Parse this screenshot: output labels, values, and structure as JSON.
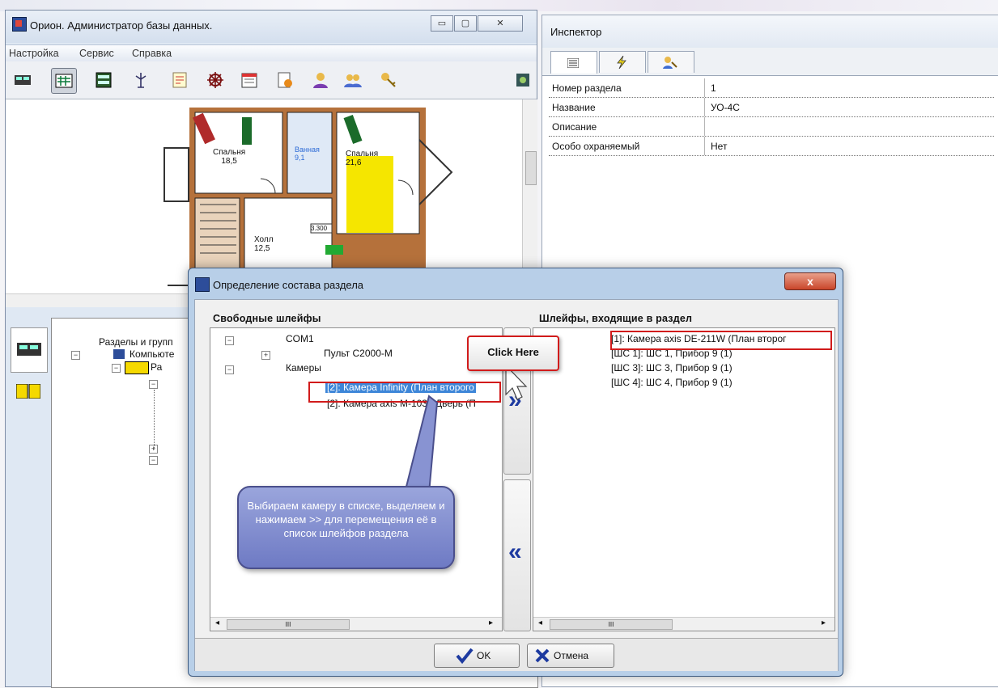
{
  "main_window": {
    "title": "Орион. Администратор базы данных.",
    "menu": [
      "Настройка",
      "Сервис",
      "Справка"
    ],
    "window_buttons": {
      "minimize": "▭",
      "maximize": "▢",
      "close": "✕"
    },
    "toolbar_icons": [
      "computers-icon",
      "loops-icon",
      "devices-icon",
      "antenna-icon",
      "document-icon",
      "helm-icon",
      "calendar-icon",
      "report-icon",
      "user-icon",
      "users-icon",
      "keys-icon",
      "settings-icon"
    ]
  },
  "floor_plan": {
    "rooms": [
      {
        "name": "Спальня",
        "area": "18,5"
      },
      {
        "name": "Ванная",
        "area": "9,1"
      },
      {
        "name": "Спальня",
        "area": "21,6"
      },
      {
        "name": "Холл",
        "area": "12,5"
      }
    ],
    "elevation_label": "3.300"
  },
  "tree": {
    "root_label": "Разделы и групп",
    "node_computer": "Компьюте",
    "node_section": "Ра"
  },
  "inspector": {
    "title": "Инспектор",
    "tabs": [
      "list-icon",
      "lightning-icon",
      "key-user-icon"
    ],
    "properties": [
      {
        "name": "Номер раздела",
        "value": "1"
      },
      {
        "name": "Название",
        "value": "УО-4С"
      },
      {
        "name": "Описание",
        "value": ""
      },
      {
        "name": "Особо охраняемый",
        "value": "Нет"
      }
    ]
  },
  "dialog": {
    "title": "Определение состава раздела",
    "close_label": "x",
    "left_label": "Свободные шлейфы",
    "right_label": "Шлейфы, входящие в раздел",
    "left_items": {
      "com": "COM1",
      "pult": "Пульт С2000-М",
      "cams": "Камеры",
      "cam1": "[2]: Камера Infinity (План второго",
      "cam2": "[2]: Камера axis M-1031 Дверь (П"
    },
    "right_items": [
      "[1]: Камера axis DE-211W (План второг",
      "[ШС 1]: ШС 1, Прибор 9 (1)",
      "[ШС 3]: ШС 3, Прибор 9 (1)",
      "[ШС 4]: ШС 4, Прибор 9 (1)"
    ],
    "move_right": "»",
    "move_left": "«",
    "scroll_mark": "III",
    "ok_label": "OK",
    "cancel_label": "Отмена"
  },
  "annotations": {
    "click_here": "Click Here",
    "hint": "Выбираем камеру в списке, выделяем и нажимаем >> для перемещения её в список шлейфов раздела"
  },
  "colors": {
    "selection": "#3d86d8",
    "annotation_red": "#d11b1b",
    "hint_bubble": "#7d88cc",
    "arrow_blue": "#1d3aa0"
  }
}
